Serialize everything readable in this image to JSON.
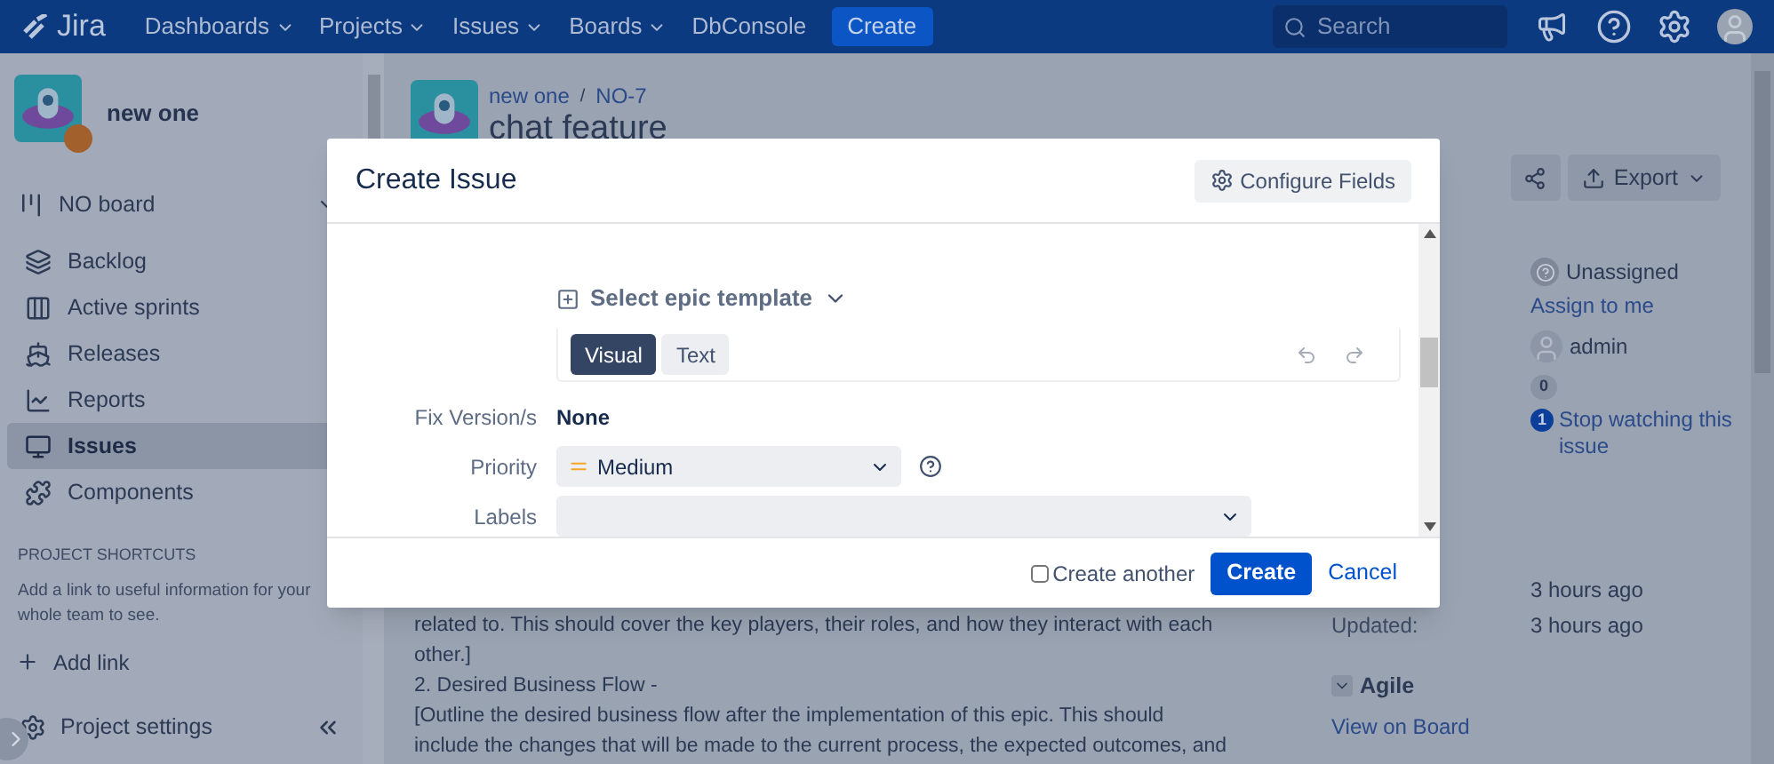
{
  "top_nav": {
    "logo": "Jira",
    "menus": [
      {
        "label": "Dashboards",
        "dropdown": true
      },
      {
        "label": "Projects",
        "dropdown": true
      },
      {
        "label": "Issues",
        "dropdown": true
      },
      {
        "label": "Boards",
        "dropdown": true
      },
      {
        "label": "DbConsole",
        "dropdown": false
      }
    ],
    "create": "Create",
    "search": {
      "placeholder": "Search"
    }
  },
  "sidebar": {
    "project": "new one",
    "board": "NO board",
    "items": [
      {
        "label": "Backlog",
        "selected": false
      },
      {
        "label": "Active sprints",
        "selected": false
      },
      {
        "label": "Releases",
        "selected": false
      },
      {
        "label": "Reports",
        "selected": false
      },
      {
        "label": "Issues",
        "selected": true
      },
      {
        "label": "Components",
        "selected": false
      }
    ],
    "shortcuts_heading": "PROJECT SHORTCUTS",
    "shortcuts_text": "Add a link to useful information for your whole team to see.",
    "add_link": "Add link",
    "settings": "Project settings"
  },
  "issue": {
    "breadcrumbs": [
      "new one",
      "NO-7"
    ],
    "separator": "/",
    "title": "chat feature",
    "export": "Export",
    "description": [
      "related to. This should cover the key players, their roles, and how they interact with each",
      "other.]",
      "2. Desired Business Flow -",
      "[Outline the desired business flow after the implementation of this epic. This should",
      "include the changes that will be made to the current process, the expected outcomes, and"
    ],
    "details": {
      "assignee": "Unassigned",
      "assign_link": "Assign to me",
      "reporter": "admin",
      "votes": "0",
      "watchers": "1",
      "watch_link": "Stop watching this issue",
      "created": "3 hours ago",
      "updated_label": "Updated:",
      "updated": "3 hours ago"
    },
    "agile": {
      "heading": "Agile",
      "expanded": true,
      "link": "View on Board"
    }
  },
  "dialog": {
    "title": "Create Issue",
    "configure": "Configure Fields",
    "template": "Select epic template",
    "editor_tabs": [
      {
        "label": "Visual",
        "selected": true
      },
      {
        "label": "Text",
        "selected": false
      }
    ],
    "fields": [
      {
        "label": "Fix Version/s",
        "kind": "text",
        "value": "None"
      },
      {
        "label": "Priority",
        "kind": "priority",
        "value": "Medium"
      },
      {
        "label": "Labels",
        "kind": "select"
      }
    ],
    "create_another": {
      "label": "Create another",
      "checked": false
    },
    "create": "Create",
    "cancel": "Cancel"
  }
}
